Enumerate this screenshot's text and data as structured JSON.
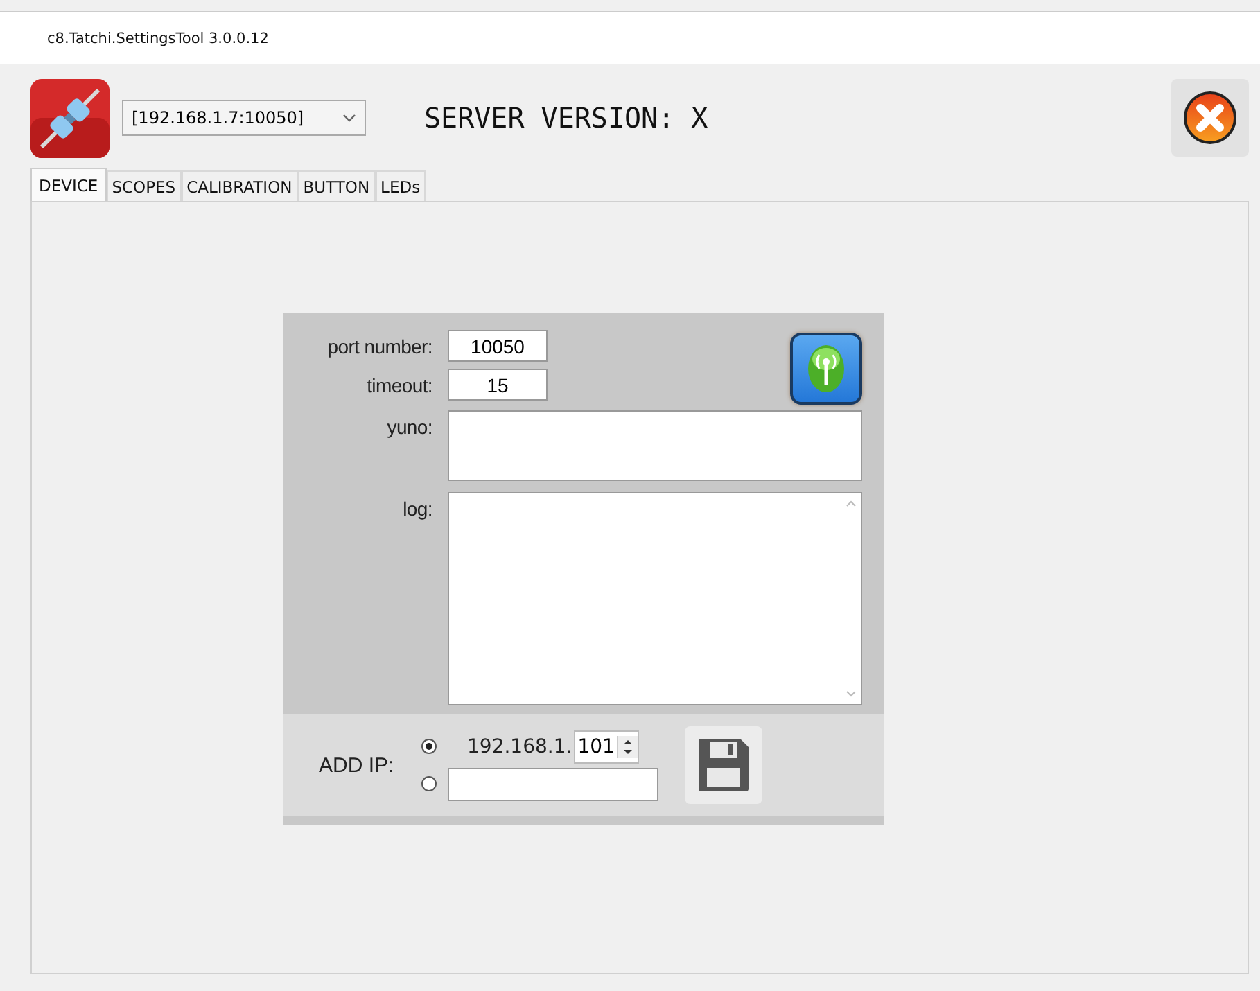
{
  "window": {
    "title": "c8.Tatchi.SettingsTool 3.0.0.12"
  },
  "connection": {
    "value": "[192.168.1.7:10050]"
  },
  "server_version": "SERVER VERSION:  X",
  "tabs": [
    {
      "label": "DEVICE",
      "selected": true
    },
    {
      "label": "SCOPES",
      "selected": false
    },
    {
      "label": "CALIBRATION",
      "selected": false
    },
    {
      "label": "BUTTON",
      "selected": false
    },
    {
      "label": "LEDs",
      "selected": false
    }
  ],
  "device": {
    "port_label": "port number:",
    "port": "10050",
    "timeout_label": "timeout:",
    "timeout": "15",
    "yuno_label": "yuno:",
    "log_label": "log:"
  },
  "add_ip": {
    "label": "ADD IP:",
    "options": [
      {
        "kind": "preset",
        "prefix": "192.168.1.",
        "value": "101",
        "selected": true
      },
      {
        "kind": "custom",
        "selected": false
      }
    ]
  }
}
